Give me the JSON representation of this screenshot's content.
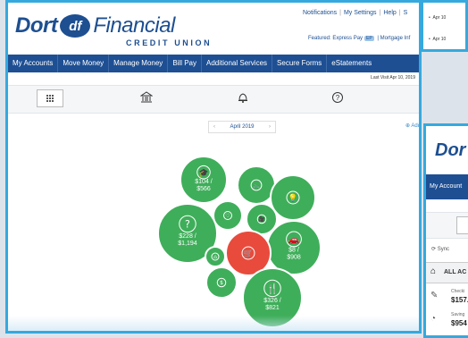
{
  "brand": {
    "name_part1": "Dort",
    "mark": "df",
    "name_part2": "Financial",
    "tagline": "CREDIT UNION"
  },
  "top_links": [
    "Notifications",
    "My Settings",
    "Help",
    "S"
  ],
  "featured": {
    "label": "Featured:",
    "link": "Express Pay",
    "badge": "EP",
    "sep": "|",
    "link2": "Mortgage Inf"
  },
  "nav": [
    "My Accounts",
    "Move Money",
    "Manage Money",
    "Bill Pay",
    "Additional Services",
    "Secure Forms",
    "eStatements"
  ],
  "last_visit": "Last Visit Apr 10, 2019",
  "date_nav": {
    "prev": "‹",
    "label": "April 2019",
    "next": "›"
  },
  "add_link": "⊕ Add",
  "bubbles": [
    {
      "id": "education",
      "icon": "graduation-cap-icon",
      "glyph": "🎓",
      "line1": "$104 /",
      "line2": "$566",
      "color": "#3fae5a"
    },
    {
      "id": "bike",
      "icon": "bicycle-icon",
      "glyph": "🚲",
      "line1": "",
      "line2": "",
      "color": "#3fae5a"
    },
    {
      "id": "utilities",
      "icon": "lightbulb-icon",
      "glyph": "💡",
      "line1": "",
      "line2": "",
      "color": "#3fae5a"
    },
    {
      "id": "health",
      "icon": "heart-pulse-icon",
      "glyph": "♡",
      "line1": "",
      "line2": "",
      "color": "#3fae5a"
    },
    {
      "id": "misc",
      "icon": "question-icon",
      "glyph": "?",
      "line1": "$228 /",
      "line2": "$1,194",
      "color": "#3fae5a"
    },
    {
      "id": "entertainment",
      "icon": "camera-icon",
      "glyph": "🎥",
      "line1": "",
      "line2": "",
      "color": "#3fae5a"
    },
    {
      "id": "auto",
      "icon": "car-icon",
      "glyph": "🚗",
      "line1": "$8 /",
      "line2": "$908",
      "color": "#3fae5a"
    },
    {
      "id": "shopping",
      "icon": "cart-icon",
      "glyph": "🛒",
      "line1": "",
      "line2": "",
      "color": "#e84b3c"
    },
    {
      "id": "home",
      "icon": "home-icon",
      "glyph": "⌂",
      "line1": "",
      "line2": "",
      "color": "#3fae5a"
    },
    {
      "id": "income",
      "icon": "dollar-icon",
      "glyph": "$",
      "line1": "",
      "line2": "",
      "color": "#3fae5a"
    },
    {
      "id": "dining",
      "icon": "utensils-icon",
      "glyph": "🍴",
      "line1": "$326 /",
      "line2": "$821",
      "color": "#3fae5a"
    }
  ],
  "right_top": {
    "rows": [
      {
        "bullet": "•",
        "text": "Apr 10"
      },
      {
        "bullet": "•",
        "text": "Apr 10"
      }
    ]
  },
  "right_bottom": {
    "logo": "Dor",
    "nav": "My Account",
    "sync": "⟳ Sync",
    "header": "ALL AC",
    "accounts": [
      {
        "label": "Checki",
        "amount": "$157."
      },
      {
        "label": "Saving",
        "amount": "$954"
      }
    ]
  },
  "colors": {
    "navy": "#1d4f91",
    "green": "#3fae5a",
    "red": "#e84b3c",
    "accent_border": "#35a9de"
  }
}
